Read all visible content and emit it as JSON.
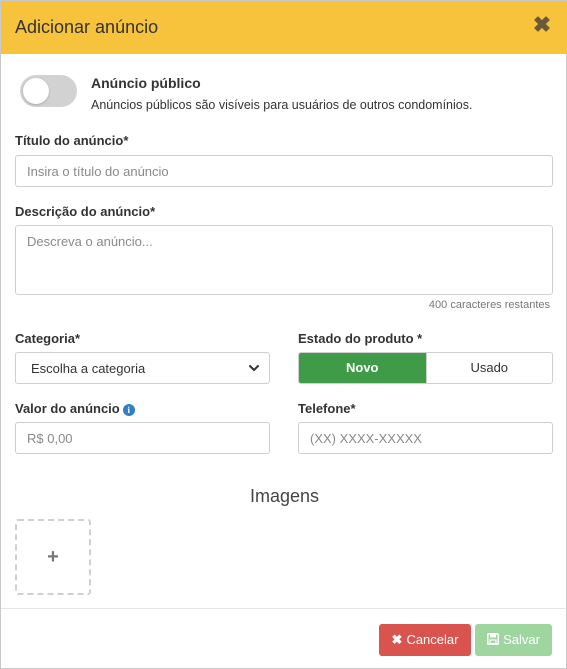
{
  "header": {
    "title": "Adicionar anúncio",
    "close_icon": "close-icon"
  },
  "toggle": {
    "on": false,
    "title": "Anúncio público",
    "description": "Anúncios públicos são visíveis para usuários de outros condomínios."
  },
  "fields": {
    "title": {
      "label": "Título do anúncio*",
      "placeholder": "Insira o título do anúncio",
      "value": ""
    },
    "description": {
      "label": "Descrição do anúncio*",
      "placeholder": "Descreva o anúncio...",
      "value": "",
      "counter": "400 caracteres restantes"
    },
    "category": {
      "label": "Categoria*",
      "value": "Escolha a categoria"
    },
    "condition": {
      "label": "Estado do produto *",
      "options": [
        "Novo",
        "Usado"
      ],
      "selected": "Novo"
    },
    "price": {
      "label": "Valor do anúncio",
      "placeholder": "R$ 0,00",
      "value": "",
      "info_icon": "info-icon"
    },
    "phone": {
      "label": "Telefone*",
      "placeholder": "(XX) XXXX-XXXXX",
      "value": ""
    }
  },
  "images": {
    "title": "Imagens",
    "add_icon": "plus-icon"
  },
  "footer": {
    "cancel_label": "Cancelar",
    "save_label": "Salvar"
  },
  "colors": {
    "header_bg": "#f8c33c",
    "active_segment": "#3f9b48",
    "cancel": "#d9534f",
    "save": "#9fd6a0",
    "info": "#2f7ec7"
  }
}
